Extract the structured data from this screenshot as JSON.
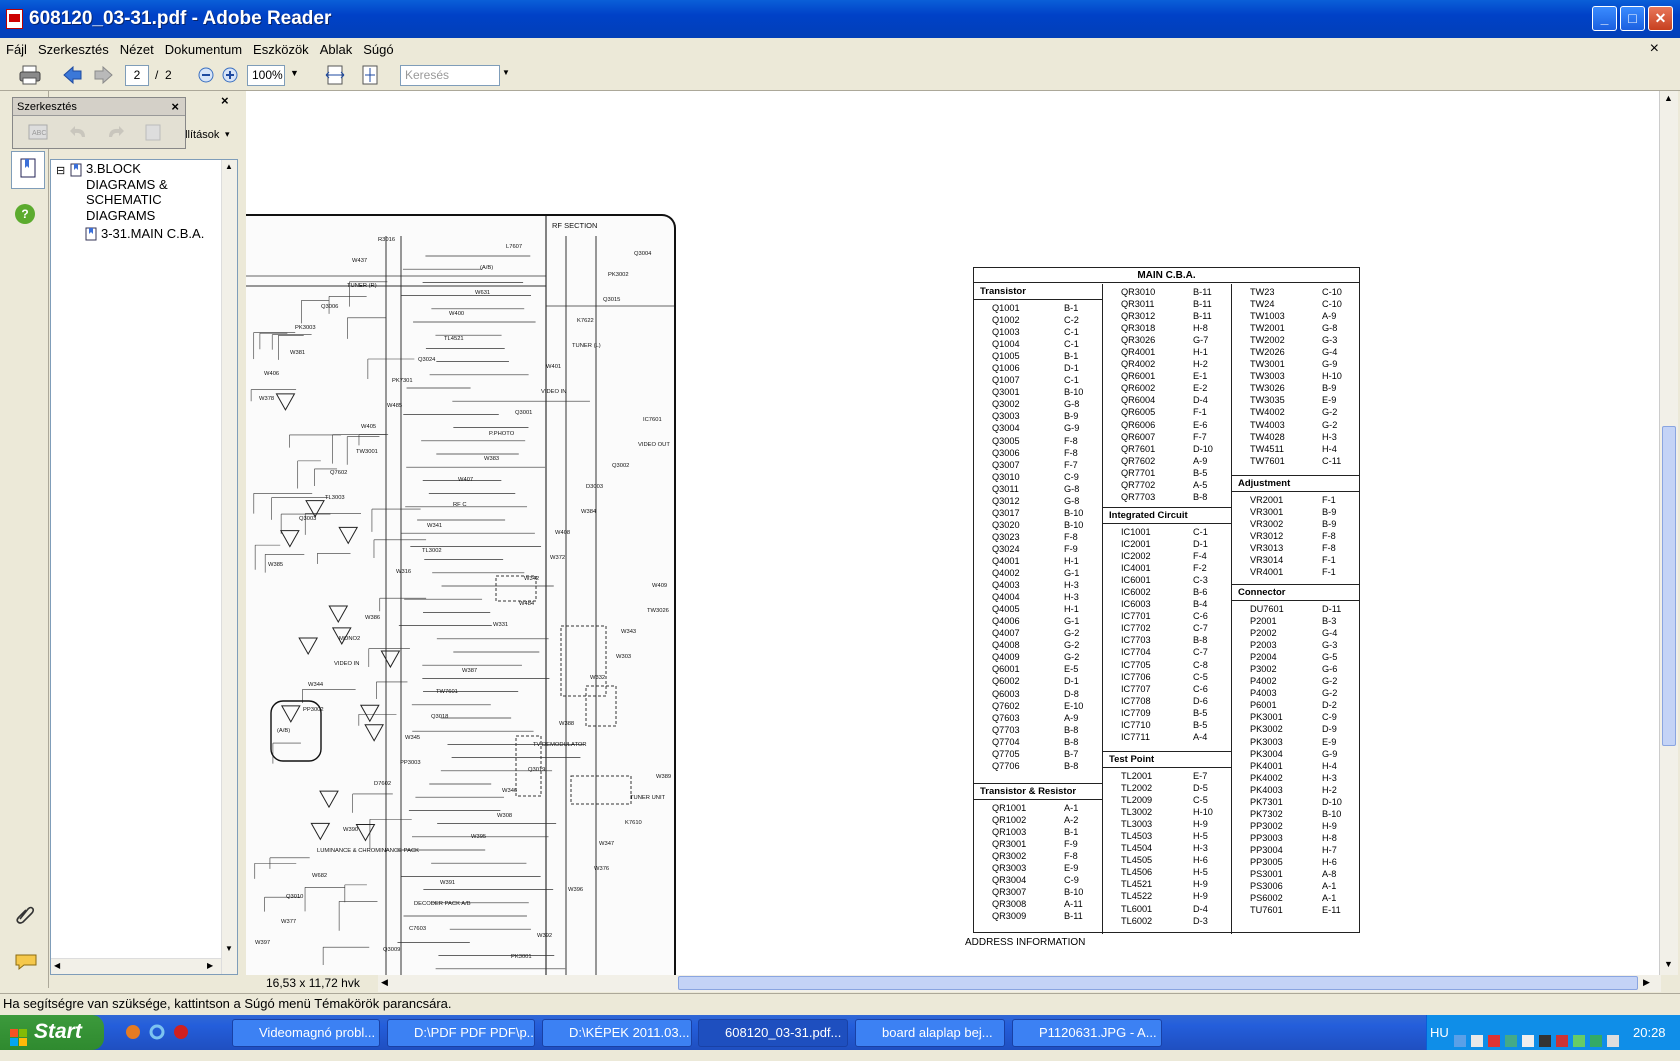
{
  "window": {
    "title": "608120_03-31.pdf - Adobe Reader",
    "min_icon": "minimize-icon",
    "max_icon": "maximize-icon",
    "close_icon": "close-icon"
  },
  "menu": [
    "Fájl",
    "Szerkesztés",
    "Nézet",
    "Dokumentum",
    "Eszközök",
    "Ablak",
    "Súgó"
  ],
  "menu_close": "×",
  "toolbar": {
    "page_current": "2",
    "page_sep": "/",
    "page_total": "2",
    "zoom": "100%",
    "search_placeholder": "Keresés"
  },
  "palette": {
    "title": "Szerkesztés",
    "close": "×",
    "partial_label": "állítások"
  },
  "navpanel": {
    "close": "×"
  },
  "bookmarks": [
    {
      "label": "3.BLOCK DIAGRAMS & SCHEMATIC DIAGRAMS",
      "toggle": "⊟"
    },
    {
      "label": "3-31.MAIN C.B.A."
    }
  ],
  "page_size": "16,53 x 11,72 hvk",
  "schematic": {
    "labels": [
      "RF SECTION",
      "TUNER (R)",
      "TL4521",
      "VIDEO IN",
      "VIDEO OUT",
      "TL3003",
      "TL3002",
      "W484",
      "W303",
      "PP3002",
      "PP3003",
      "W308",
      "W376",
      "W377",
      "R3016",
      "W631",
      "TUNER (L)",
      "W378",
      "TW3001",
      "RF C",
      "W372",
      "TW3026",
      "VIDEO IN",
      "Q3018",
      "Q3019",
      "K7610",
      "W682",
      "C7603",
      "L7607",
      "Q3015",
      "W381",
      "W485",
      "W383",
      "W384",
      "W385",
      "W386",
      "W387",
      "W388",
      "W389",
      "W390",
      "W391",
      "W392",
      "Q3004",
      "Q3006",
      "Q3024",
      "Q3001",
      "Q3002",
      "Q3003",
      "W316",
      "W331",
      "W332",
      "(A/B)",
      "D7602",
      "W395",
      "W396",
      "W397",
      "W437",
      "W400",
      "W401",
      "IC7601",
      "Q7602",
      "W341",
      "W342",
      "W343",
      "W344",
      "W345",
      "W346",
      "W347",
      "Q3010",
      "Q3009",
      "(A/B)",
      "K7622",
      "W406",
      "W405",
      "W407",
      "W408",
      "W409",
      "MONO2",
      "TW7601",
      "TV DEMODULATOR",
      "TUNER UNIT",
      "LUMINANCE & CHROMINANCE PACK",
      "DECODER PACK A/B",
      "PK3001",
      "PK3002",
      "PK3003",
      "PK7301",
      "P.PHOTO",
      "D3003"
    ]
  },
  "cba": {
    "title": "MAIN C.B.A.",
    "transistor": {
      "title": "Transistor",
      "rows": [
        [
          "Q1001",
          "B-1"
        ],
        [
          "Q1002",
          "C-2"
        ],
        [
          "Q1003",
          "C-1"
        ],
        [
          "Q1004",
          "C-1"
        ],
        [
          "Q1005",
          "B-1"
        ],
        [
          "Q1006",
          "D-1"
        ],
        [
          "Q1007",
          "C-1"
        ],
        [
          "Q3001",
          "B-10"
        ],
        [
          "Q3002",
          "G-8"
        ],
        [
          "Q3003",
          "B-9"
        ],
        [
          "Q3004",
          "G-9"
        ],
        [
          "Q3005",
          "F-8"
        ],
        [
          "Q3006",
          "F-8"
        ],
        [
          "Q3007",
          "F-7"
        ],
        [
          "Q3010",
          "C-9"
        ],
        [
          "Q3011",
          "G-8"
        ],
        [
          "Q3012",
          "G-8"
        ],
        [
          "Q3017",
          "B-10"
        ],
        [
          "Q3020",
          "B-10"
        ],
        [
          "Q3023",
          "F-8"
        ],
        [
          "Q3024",
          "F-9"
        ],
        [
          "Q4001",
          "H-1"
        ],
        [
          "Q4002",
          "G-1"
        ],
        [
          "Q4003",
          "H-3"
        ],
        [
          "Q4004",
          "H-3"
        ],
        [
          "Q4005",
          "H-1"
        ],
        [
          "Q4006",
          "G-1"
        ],
        [
          "Q4007",
          "G-2"
        ],
        [
          "Q4008",
          "G-2"
        ],
        [
          "Q4009",
          "G-2"
        ],
        [
          "Q6001",
          "E-5"
        ],
        [
          "Q6002",
          "D-1"
        ],
        [
          "Q6003",
          "D-8"
        ],
        [
          "Q7602",
          "E-10"
        ],
        [
          "Q7603",
          "A-9"
        ],
        [
          "Q7703",
          "B-8"
        ],
        [
          "Q7704",
          "B-8"
        ],
        [
          "Q7705",
          "B-7"
        ],
        [
          "Q7706",
          "B-8"
        ]
      ]
    },
    "transres": {
      "title": "Transistor & Resistor",
      "rows": [
        [
          "QR1001",
          "A-1"
        ],
        [
          "QR1002",
          "A-2"
        ],
        [
          "QR1003",
          "B-1"
        ],
        [
          "QR3001",
          "F-9"
        ],
        [
          "QR3002",
          "F-8"
        ],
        [
          "QR3003",
          "E-9"
        ],
        [
          "QR3004",
          "C-9"
        ],
        [
          "QR3007",
          "B-10"
        ],
        [
          "QR3008",
          "A-11"
        ],
        [
          "QR3009",
          "B-11"
        ]
      ]
    },
    "qr": {
      "rows": [
        [
          "QR3010",
          "B-11"
        ],
        [
          "QR3011",
          "B-11"
        ],
        [
          "QR3012",
          "B-11"
        ],
        [
          "QR3018",
          "H-8"
        ],
        [
          "QR3026",
          "G-7"
        ],
        [
          "QR4001",
          "H-1"
        ],
        [
          "QR4002",
          "H-2"
        ],
        [
          "QR6001",
          "E-1"
        ],
        [
          "QR6002",
          "E-2"
        ],
        [
          "QR6004",
          "D-4"
        ],
        [
          "QR6005",
          "F-1"
        ],
        [
          "QR6006",
          "E-6"
        ],
        [
          "QR6007",
          "F-7"
        ],
        [
          "QR7601",
          "D-10"
        ],
        [
          "QR7602",
          "A-9"
        ],
        [
          "QR7701",
          "B-5"
        ],
        [
          "QR7702",
          "A-5"
        ],
        [
          "QR7703",
          "B-8"
        ]
      ]
    },
    "ic": {
      "title": "Integrated Circuit",
      "rows": [
        [
          "IC1001",
          "C-1"
        ],
        [
          "IC2001",
          "D-1"
        ],
        [
          "IC2002",
          "F-4"
        ],
        [
          "IC4001",
          "F-2"
        ],
        [
          "IC6001",
          "C-3"
        ],
        [
          "IC6002",
          "B-6"
        ],
        [
          "IC6003",
          "B-4"
        ],
        [
          "IC7701",
          "C-6"
        ],
        [
          "IC7702",
          "C-7"
        ],
        [
          "IC7703",
          "B-8"
        ],
        [
          "IC7704",
          "C-7"
        ],
        [
          "IC7705",
          "C-8"
        ],
        [
          "IC7706",
          "C-5"
        ],
        [
          "IC7707",
          "C-6"
        ],
        [
          "IC7708",
          "D-6"
        ],
        [
          "IC7709",
          "B-5"
        ],
        [
          "IC7710",
          "B-5"
        ],
        [
          "IC7711",
          "A-4"
        ]
      ]
    },
    "tp": {
      "title": "Test Point",
      "rows": [
        [
          "TL2001",
          "E-7"
        ],
        [
          "TL2002",
          "D-5"
        ],
        [
          "TL2009",
          "C-5"
        ],
        [
          "TL3002",
          "H-10"
        ],
        [
          "TL3003",
          "H-9"
        ],
        [
          "TL4503",
          "H-5"
        ],
        [
          "TL4504",
          "H-3"
        ],
        [
          "TL4505",
          "H-6"
        ],
        [
          "TL4506",
          "H-5"
        ],
        [
          "TL4521",
          "H-9"
        ],
        [
          "TL4522",
          "H-9"
        ],
        [
          "TL6001",
          "D-4"
        ],
        [
          "TL6002",
          "D-3"
        ]
      ]
    },
    "tw": {
      "rows": [
        [
          "TW23",
          "C-10"
        ],
        [
          "TW24",
          "C-10"
        ],
        [
          "TW1003",
          "A-9"
        ],
        [
          "TW2001",
          "G-8"
        ],
        [
          "TW2002",
          "G-3"
        ],
        [
          "TW2026",
          "G-4"
        ],
        [
          "TW3001",
          "G-9"
        ],
        [
          "TW3003",
          "H-10"
        ],
        [
          "TW3026",
          "B-9"
        ],
        [
          "TW3035",
          "E-9"
        ],
        [
          "TW4002",
          "G-2"
        ],
        [
          "TW4003",
          "G-2"
        ],
        [
          "TW4028",
          "H-3"
        ],
        [
          "TW4511",
          "H-4"
        ],
        [
          "TW7601",
          "C-11"
        ]
      ]
    },
    "adj": {
      "title": "Adjustment",
      "rows": [
        [
          "VR2001",
          "F-1"
        ],
        [
          "VR3001",
          "B-9"
        ],
        [
          "VR3002",
          "B-9"
        ],
        [
          "VR3012",
          "F-8"
        ],
        [
          "VR3013",
          "F-8"
        ],
        [
          "VR3014",
          "F-1"
        ],
        [
          "VR4001",
          "F-1"
        ]
      ]
    },
    "conn": {
      "title": "Connector",
      "rows": [
        [
          "DU7601",
          "D-11"
        ],
        [
          "P2001",
          "B-3"
        ],
        [
          "P2002",
          "G-4"
        ],
        [
          "P2003",
          "G-3"
        ],
        [
          "P2004",
          "G-5"
        ],
        [
          "P3002",
          "G-6"
        ],
        [
          "P4002",
          "G-2"
        ],
        [
          "P4003",
          "G-2"
        ],
        [
          "P6001",
          "D-2"
        ],
        [
          "PK3001",
          "C-9"
        ],
        [
          "PK3002",
          "D-9"
        ],
        [
          "PK3003",
          "E-9"
        ],
        [
          "PK3004",
          "G-9"
        ],
        [
          "PK4001",
          "H-4"
        ],
        [
          "PK4002",
          "H-3"
        ],
        [
          "PK4003",
          "H-2"
        ],
        [
          "PK7301",
          "D-10"
        ],
        [
          "PK7302",
          "B-10"
        ],
        [
          "PP3002",
          "H-9"
        ],
        [
          "PP3003",
          "H-8"
        ],
        [
          "PP3004",
          "H-7"
        ],
        [
          "PP3005",
          "H-6"
        ],
        [
          "PS3001",
          "A-8"
        ],
        [
          "PS3006",
          "A-1"
        ],
        [
          "PS6002",
          "A-1"
        ],
        [
          "TU7601",
          "E-11"
        ]
      ]
    },
    "footer": "ADDRESS INFORMATION"
  },
  "status": "Ha segítségre van szüksége, kattintson a Súgó menü Témakörök parancsára.",
  "taskbar": {
    "start": "Start",
    "tasks": [
      "Videomagnó probl...",
      "D:\\PDF PDF PDF\\p...",
      "D:\\KÉPEK 2011.03...",
      "608120_03-31.pdf...",
      "board alaplap bej...",
      "P1120631.JPG - A..."
    ],
    "lang": "HU",
    "clock": "20:28"
  }
}
